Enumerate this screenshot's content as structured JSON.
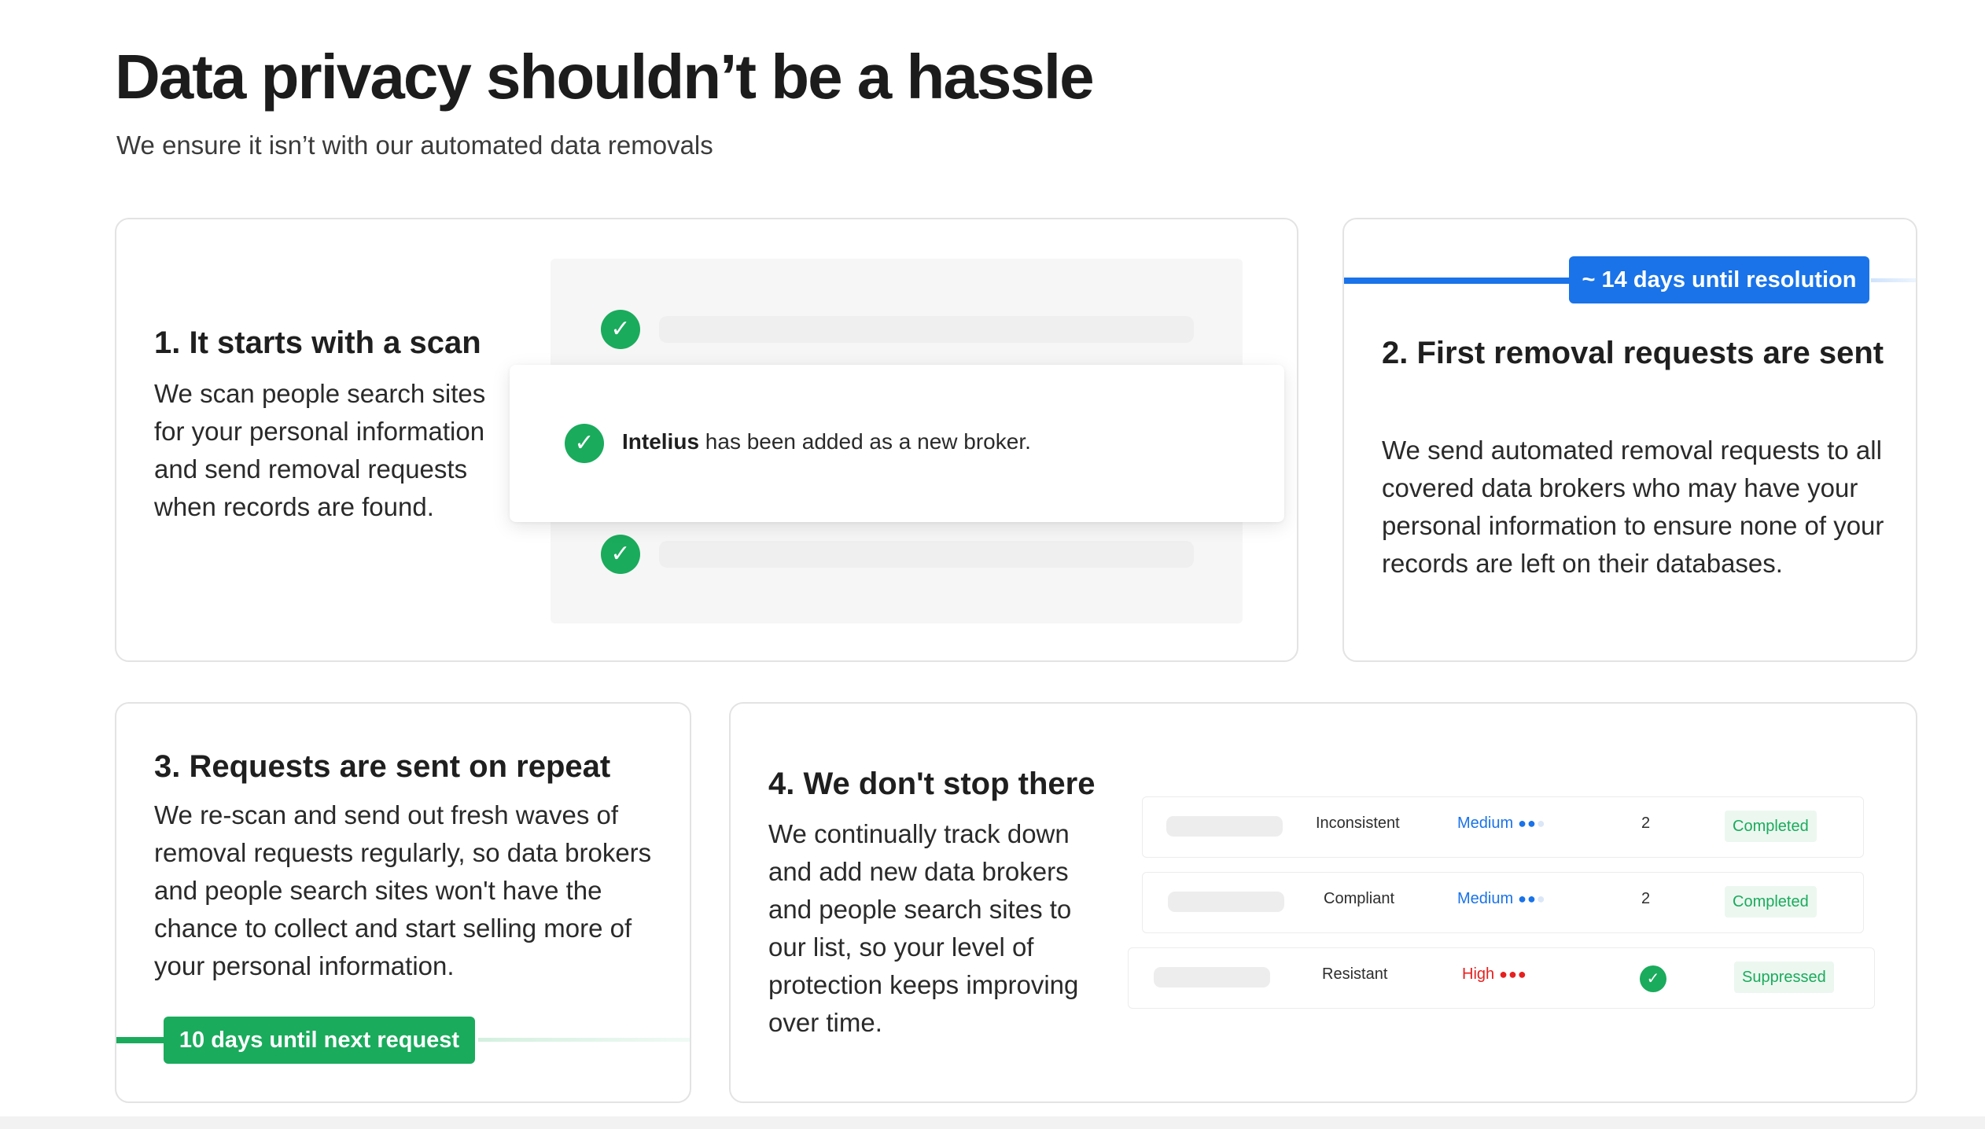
{
  "header": {
    "title": "Data privacy shouldn’t be a hassle",
    "subtitle": "We ensure it isn’t with our automated data removals"
  },
  "card1": {
    "heading": "1. It starts with a scan",
    "body": "We scan people search sites for your personal information and send removal requests when records are found.",
    "broker_name": "Intelius",
    "broker_message": " has been added as a new broker."
  },
  "card2": {
    "badge": "~ 14 days until resolution",
    "heading": "2. First removal requests are sent",
    "body": "We send automated removal requests to all covered data brokers who may have your personal information to ensure none of your records are left on their databases."
  },
  "card3": {
    "heading": "3. Requests are sent on repeat",
    "body": "We re-scan and send out fresh waves of removal requests regularly, so data brokers and people search sites won't have the chance to collect and start selling more of your personal information.",
    "badge": "10 days until next request"
  },
  "card4": {
    "heading": "4. We don't stop there",
    "body": "We continually track down and add new data brokers and people search sites to our list, so your level of protection keeps improving over time.",
    "brokers": [
      {
        "status": "Inconsistent",
        "level": "Medium",
        "count": "2",
        "result": "Completed"
      },
      {
        "status": "Compliant",
        "level": "Medium",
        "count": "2",
        "result": "Completed"
      },
      {
        "status": "Resistant",
        "level": "High",
        "count": "check-icon",
        "result": "Suppressed"
      }
    ]
  },
  "colors": {
    "accent_green": "#1aab5c",
    "accent_blue": "#1a73e8",
    "risk_red": "#e62020"
  }
}
